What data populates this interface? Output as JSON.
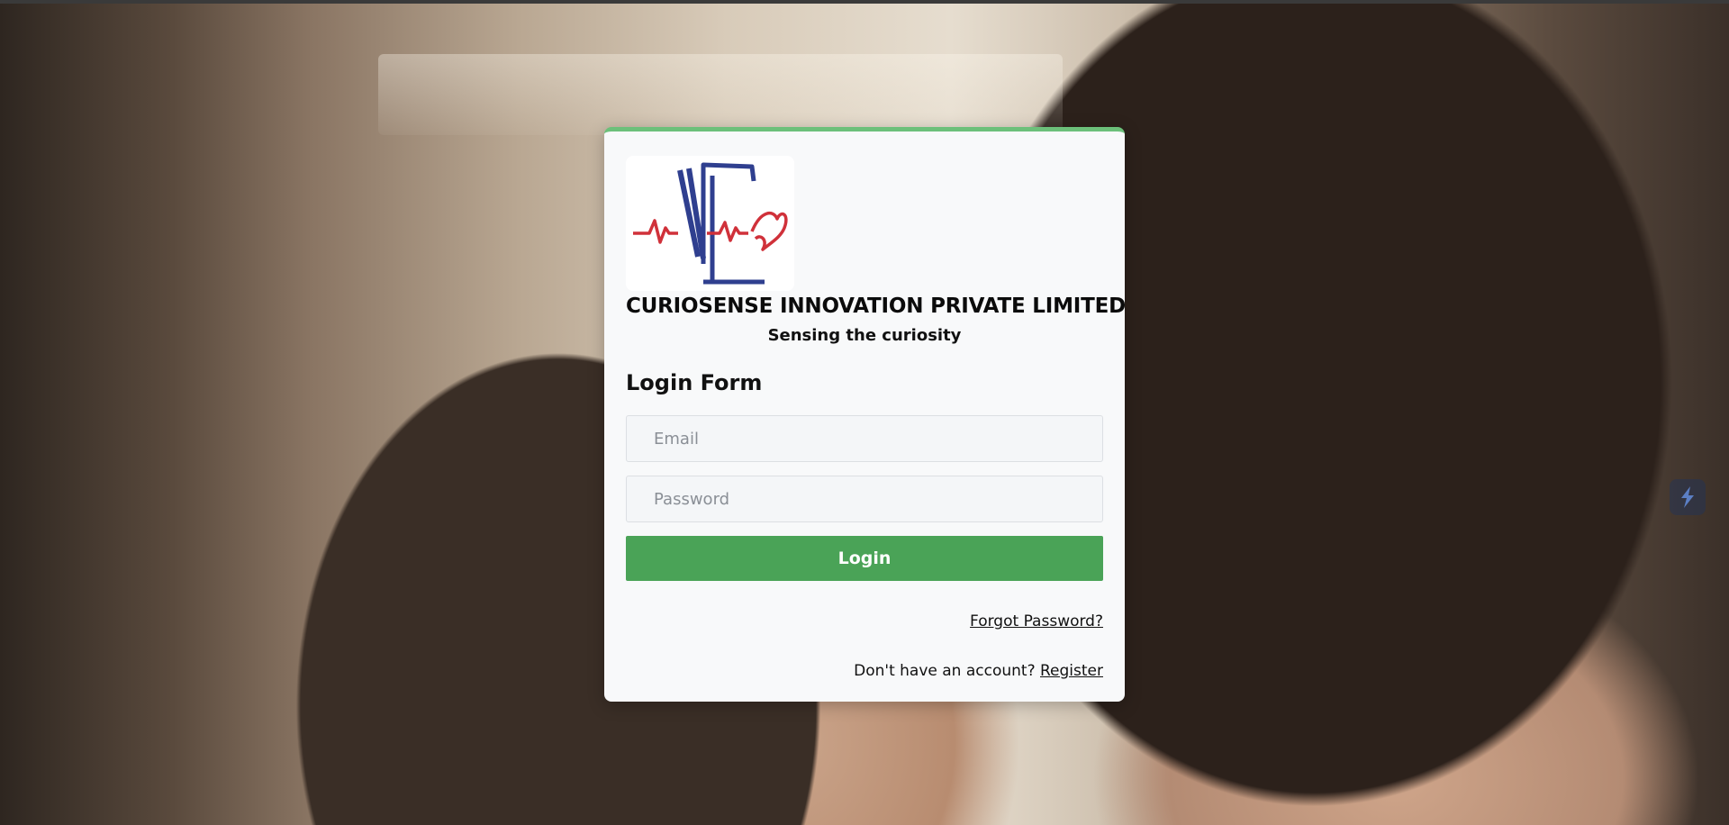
{
  "brand": {
    "company_name": "CURIOSENSE INNOVATION PRIVATE LIMITED",
    "tagline": "Sensing the curiosity",
    "logo_icon": "curiosense-heartbeat-logo",
    "colors": {
      "logo_blue": "#2f3f8f",
      "logo_red": "#d0313a"
    }
  },
  "form": {
    "title": "Login Form",
    "email_placeholder": "Email",
    "password_placeholder": "Password",
    "login_label": "Login",
    "forgot_label": "Forgot Password?",
    "register_prompt": "Don't have an account?",
    "register_label": "Register"
  },
  "colors": {
    "accent_green": "#4aa357",
    "card_top_border": "#6cc07a",
    "card_background": "#f8f9fa"
  },
  "side_widget_icon": "lightning-icon"
}
